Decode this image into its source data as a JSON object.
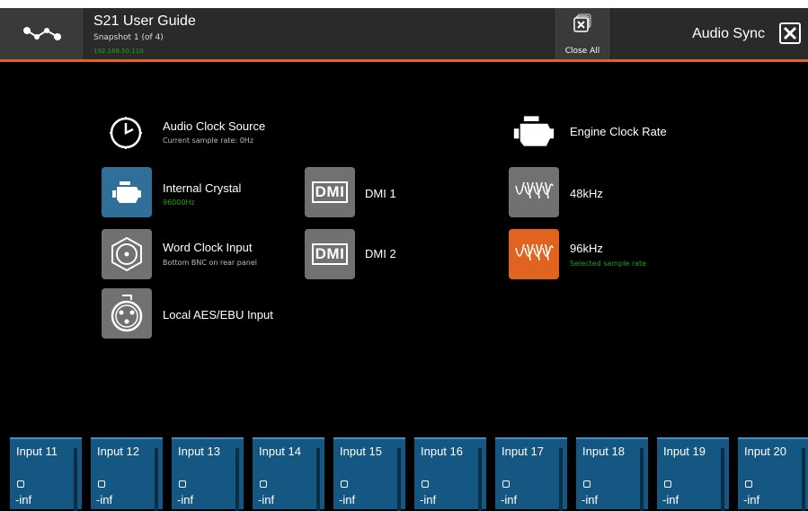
{
  "header": {
    "title": "S21 User Guide",
    "snapshot": "Snapshot 1 (of 4)",
    "ip": "192.168.50.110",
    "close_all_label": "Close All",
    "sync_label": "Audio Sync"
  },
  "clock_source": {
    "title": "Audio Clock Source",
    "subtitle": "Current sample rate: 0Hz",
    "options": [
      {
        "label": "Internal Crystal",
        "sub": "96000Hz",
        "state": "selected"
      },
      {
        "label": "Word Clock Input",
        "sub": "Bottom BNC on rear panel"
      },
      {
        "label": "Local AES/EBU Input",
        "sub": ""
      }
    ],
    "dmi": [
      {
        "badge": "DMI",
        "label": "DMI 1"
      },
      {
        "badge": "DMI",
        "label": "DMI 2"
      }
    ]
  },
  "engine": {
    "title": "Engine Clock Rate",
    "rates": [
      {
        "label": "48kHz",
        "sub": ""
      },
      {
        "label": "96kHz",
        "sub": "Selected sample rate",
        "state": "selected"
      }
    ]
  },
  "strips": [
    {
      "name": "Input 11",
      "level": "-inf"
    },
    {
      "name": "Input 12",
      "level": "-inf"
    },
    {
      "name": "Input 13",
      "level": "-inf"
    },
    {
      "name": "Input 14",
      "level": "-inf"
    },
    {
      "name": "Input 15",
      "level": "-inf"
    },
    {
      "name": "Input 16",
      "level": "-inf"
    },
    {
      "name": "Input 17",
      "level": "-inf"
    },
    {
      "name": "Input 18",
      "level": "-inf"
    },
    {
      "name": "Input 19",
      "level": "-inf"
    },
    {
      "name": "Input 20",
      "level": "-inf"
    }
  ],
  "colors": {
    "accent": "#e06320",
    "selected_blue": "#2f6f9a",
    "strip_blue": "#155783",
    "ok_green": "#1aa51a"
  }
}
